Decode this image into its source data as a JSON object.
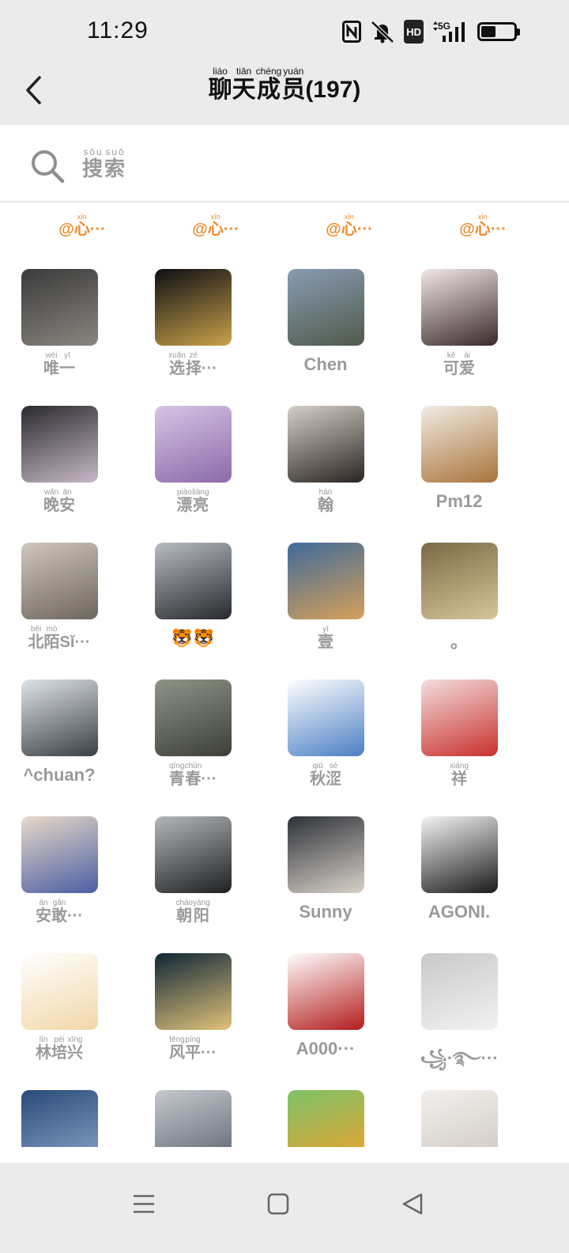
{
  "status": {
    "time": "11:29",
    "network": "5G",
    "hd": "HD"
  },
  "header": {
    "title_chars": [
      {
        "ch": "聊",
        "py": "liáo"
      },
      {
        "ch": "天",
        "py": "tiān"
      },
      {
        "ch": "成",
        "py": "chéng"
      },
      {
        "ch": "员",
        "py": "yuán"
      }
    ],
    "count": "(197)"
  },
  "search": {
    "chars": [
      {
        "ch": "搜",
        "py": "sōu"
      },
      {
        "ch": "索",
        "py": "suǒ"
      }
    ]
  },
  "mentions": [
    {
      "at": "@",
      "ch": "心",
      "py": "xīn",
      "more": "···"
    },
    {
      "at": "@",
      "ch": "心",
      "py": "xīn",
      "more": "···"
    },
    {
      "at": "@",
      "ch": "心",
      "py": "xīn",
      "more": "···"
    },
    {
      "at": "@",
      "ch": "心",
      "py": "xīn",
      "more": "···"
    }
  ],
  "members": [
    {
      "name": "唯一",
      "ruby": [
        [
          "唯",
          "wéi"
        ],
        [
          "一",
          "yī"
        ]
      ],
      "more": "",
      "avatar": [
        "#3a3a3a",
        "#8a8680"
      ]
    },
    {
      "name": "选择···",
      "ruby": [
        [
          "选",
          "xuǎn"
        ],
        [
          "择",
          "zé"
        ]
      ],
      "more": "···",
      "avatar": [
        "#0e0e12",
        "#c9a24a"
      ]
    },
    {
      "name": "Chen",
      "latin": true,
      "avatar": [
        "#8a9bb3",
        "#4f5a4a"
      ]
    },
    {
      "name": "可爱",
      "ruby": [
        [
          "可",
          "kě"
        ],
        [
          "爱",
          "ài"
        ]
      ],
      "more": "",
      "avatar": [
        "#f2e6e6",
        "#3a2a2a"
      ]
    },
    {
      "name": "晚安",
      "ruby": [
        [
          "晚",
          "wǎn"
        ],
        [
          "安",
          "ān"
        ]
      ],
      "more": "",
      "avatar": [
        "#2a2a2e",
        "#c7b8c8"
      ]
    },
    {
      "name": "漂亮",
      "ruby": [
        [
          "漂",
          "piào"
        ],
        [
          "亮",
          "liàng"
        ]
      ],
      "more": "",
      "avatar": [
        "#d8c4e6",
        "#8b6aa8"
      ]
    },
    {
      "name": "翰",
      "ruby": [
        [
          "翰",
          "hàn"
        ]
      ],
      "more": "",
      "avatar": [
        "#d6cfc7",
        "#2a2522"
      ]
    },
    {
      "name": "Pm12",
      "latin": true,
      "avatar": [
        "#f1ece4",
        "#a9743a"
      ]
    },
    {
      "name": "北陌Sǐ···",
      "ruby": [
        [
          "北",
          "běi"
        ],
        [
          "陌",
          "mò"
        ]
      ],
      "more": "Sǐ···",
      "avatar": [
        "#cfc6bd",
        "#6e665d"
      ]
    },
    {
      "name": "🐯🐯",
      "latin": true,
      "avatar": [
        "#b7bcc4",
        "#26292c"
      ]
    },
    {
      "name": "壹",
      "ruby": [
        [
          "壹",
          "yī"
        ]
      ],
      "more": "",
      "avatar": [
        "#3f6a9a",
        "#d6a05a"
      ]
    },
    {
      "name": "。",
      "latin": true,
      "avatar": [
        "#7a6a45",
        "#d8c69a"
      ]
    },
    {
      "name": "^chuan?",
      "latin": true,
      "avatar": [
        "#dfe4ea",
        "#3a3f46"
      ]
    },
    {
      "name": "青春···",
      "ruby": [
        [
          "青",
          "qīng"
        ],
        [
          "春",
          "chūn"
        ]
      ],
      "more": "···",
      "avatar": [
        "#8f9488",
        "#3c3f36"
      ]
    },
    {
      "name": "秋涩",
      "ruby": [
        [
          "秋",
          "qiū"
        ],
        [
          "涩",
          "sè"
        ]
      ],
      "more": "",
      "avatar": [
        "#ffffff",
        "#4b7fc4"
      ]
    },
    {
      "name": "祥",
      "ruby": [
        [
          "祥",
          "xiáng"
        ]
      ],
      "more": "",
      "avatar": [
        "#f3dede",
        "#c8302c"
      ]
    },
    {
      "name": "安敢···",
      "ruby": [
        [
          "安",
          "ān"
        ],
        [
          "敢",
          "gǎn"
        ]
      ],
      "more": "···",
      "avatar": [
        "#e8d9c9",
        "#4a5ea3"
      ]
    },
    {
      "name": "朝阳",
      "ruby": [
        [
          "朝",
          "cháo"
        ],
        [
          "阳",
          "yáng"
        ]
      ],
      "more": "",
      "avatar": [
        "#b4b7b9",
        "#1d1f21"
      ]
    },
    {
      "name": "Sunny",
      "latin": true,
      "avatar": [
        "#2d3138",
        "#d9d2c9"
      ]
    },
    {
      "name": "AGONI.",
      "latin": true,
      "avatar": [
        "#f4f4f4",
        "#1a1a1a"
      ]
    },
    {
      "name": "林培兴",
      "ruby": [
        [
          "林",
          "lín"
        ],
        [
          "培",
          "péi"
        ],
        [
          "兴",
          "xīng"
        ]
      ],
      "more": "",
      "avatar": [
        "#ffffff",
        "#f2d7a8"
      ]
    },
    {
      "name": "风平···",
      "ruby": [
        [
          "风",
          "fēng"
        ],
        [
          "平",
          "píng"
        ]
      ],
      "more": "···",
      "avatar": [
        "#0f2636",
        "#e0c27a"
      ]
    },
    {
      "name": "A000···",
      "latin": true,
      "avatar": [
        "#ffffff",
        "#b31c1c"
      ]
    },
    {
      "name": "꧁·࿐···",
      "latin": true,
      "avatar": [
        "#c9c9c9",
        "#f2f2f2"
      ]
    },
    {
      "name": "",
      "latin": true,
      "avatar": [
        "#2a4a78",
        "#8aa4c8"
      ]
    },
    {
      "name": "",
      "latin": true,
      "avatar": [
        "#c5c9cf",
        "#5b6470"
      ]
    },
    {
      "name": "",
      "latin": true,
      "avatar": [
        "#7cc26a",
        "#f0a12a"
      ]
    },
    {
      "name": "",
      "latin": true,
      "avatar": [
        "#f2f0ee",
        "#cfc7be"
      ]
    }
  ],
  "icons": {
    "back": "back-arrow-icon",
    "search": "search-icon",
    "nfc": "nfc-icon",
    "mute": "mute-bell-icon",
    "signal": "signal-icon",
    "battery": "battery-icon",
    "menu": "menu-icon",
    "home": "home-icon",
    "nav_back": "nav-back-icon"
  }
}
